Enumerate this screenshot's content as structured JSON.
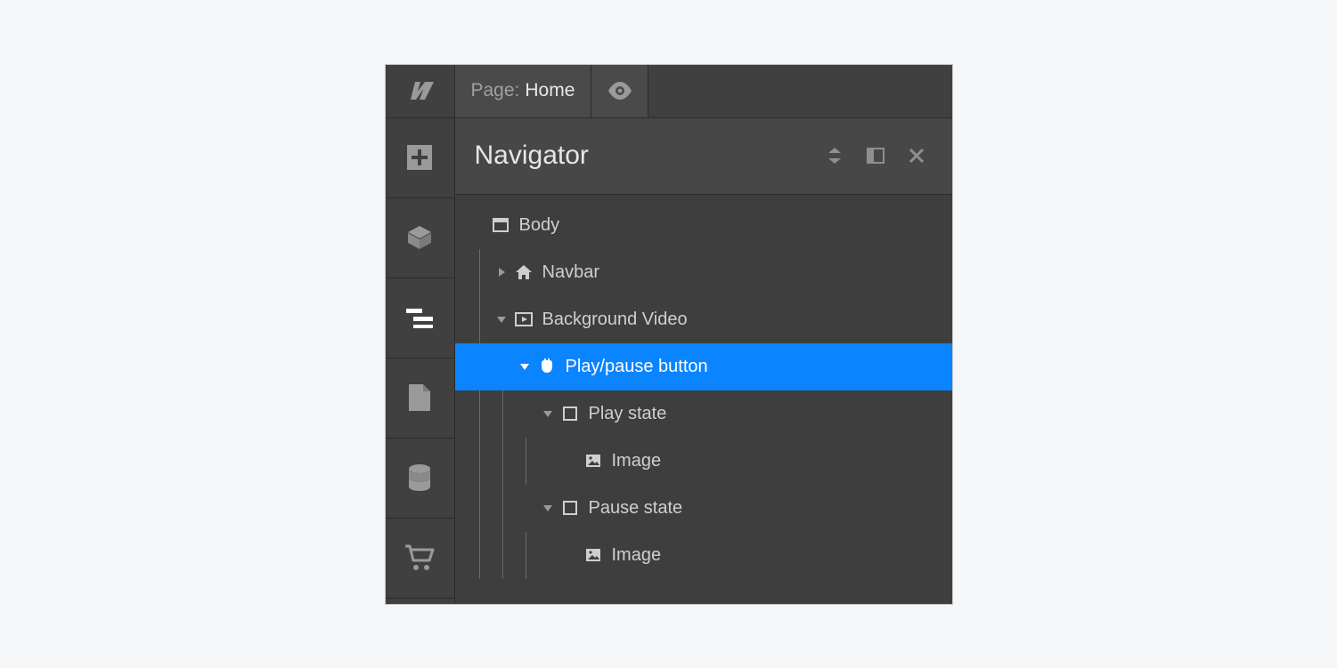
{
  "topbar": {
    "page_label": "Page:",
    "page_name": "Home"
  },
  "navigator": {
    "title": "Navigator"
  },
  "tree": {
    "body": "Body",
    "navbar": "Navbar",
    "bgvideo": "Background Video",
    "playpause": "Play/pause button",
    "playstate": "Play state",
    "playimage": "Image",
    "pausestate": "Pause state",
    "pauseimage": "Image"
  }
}
